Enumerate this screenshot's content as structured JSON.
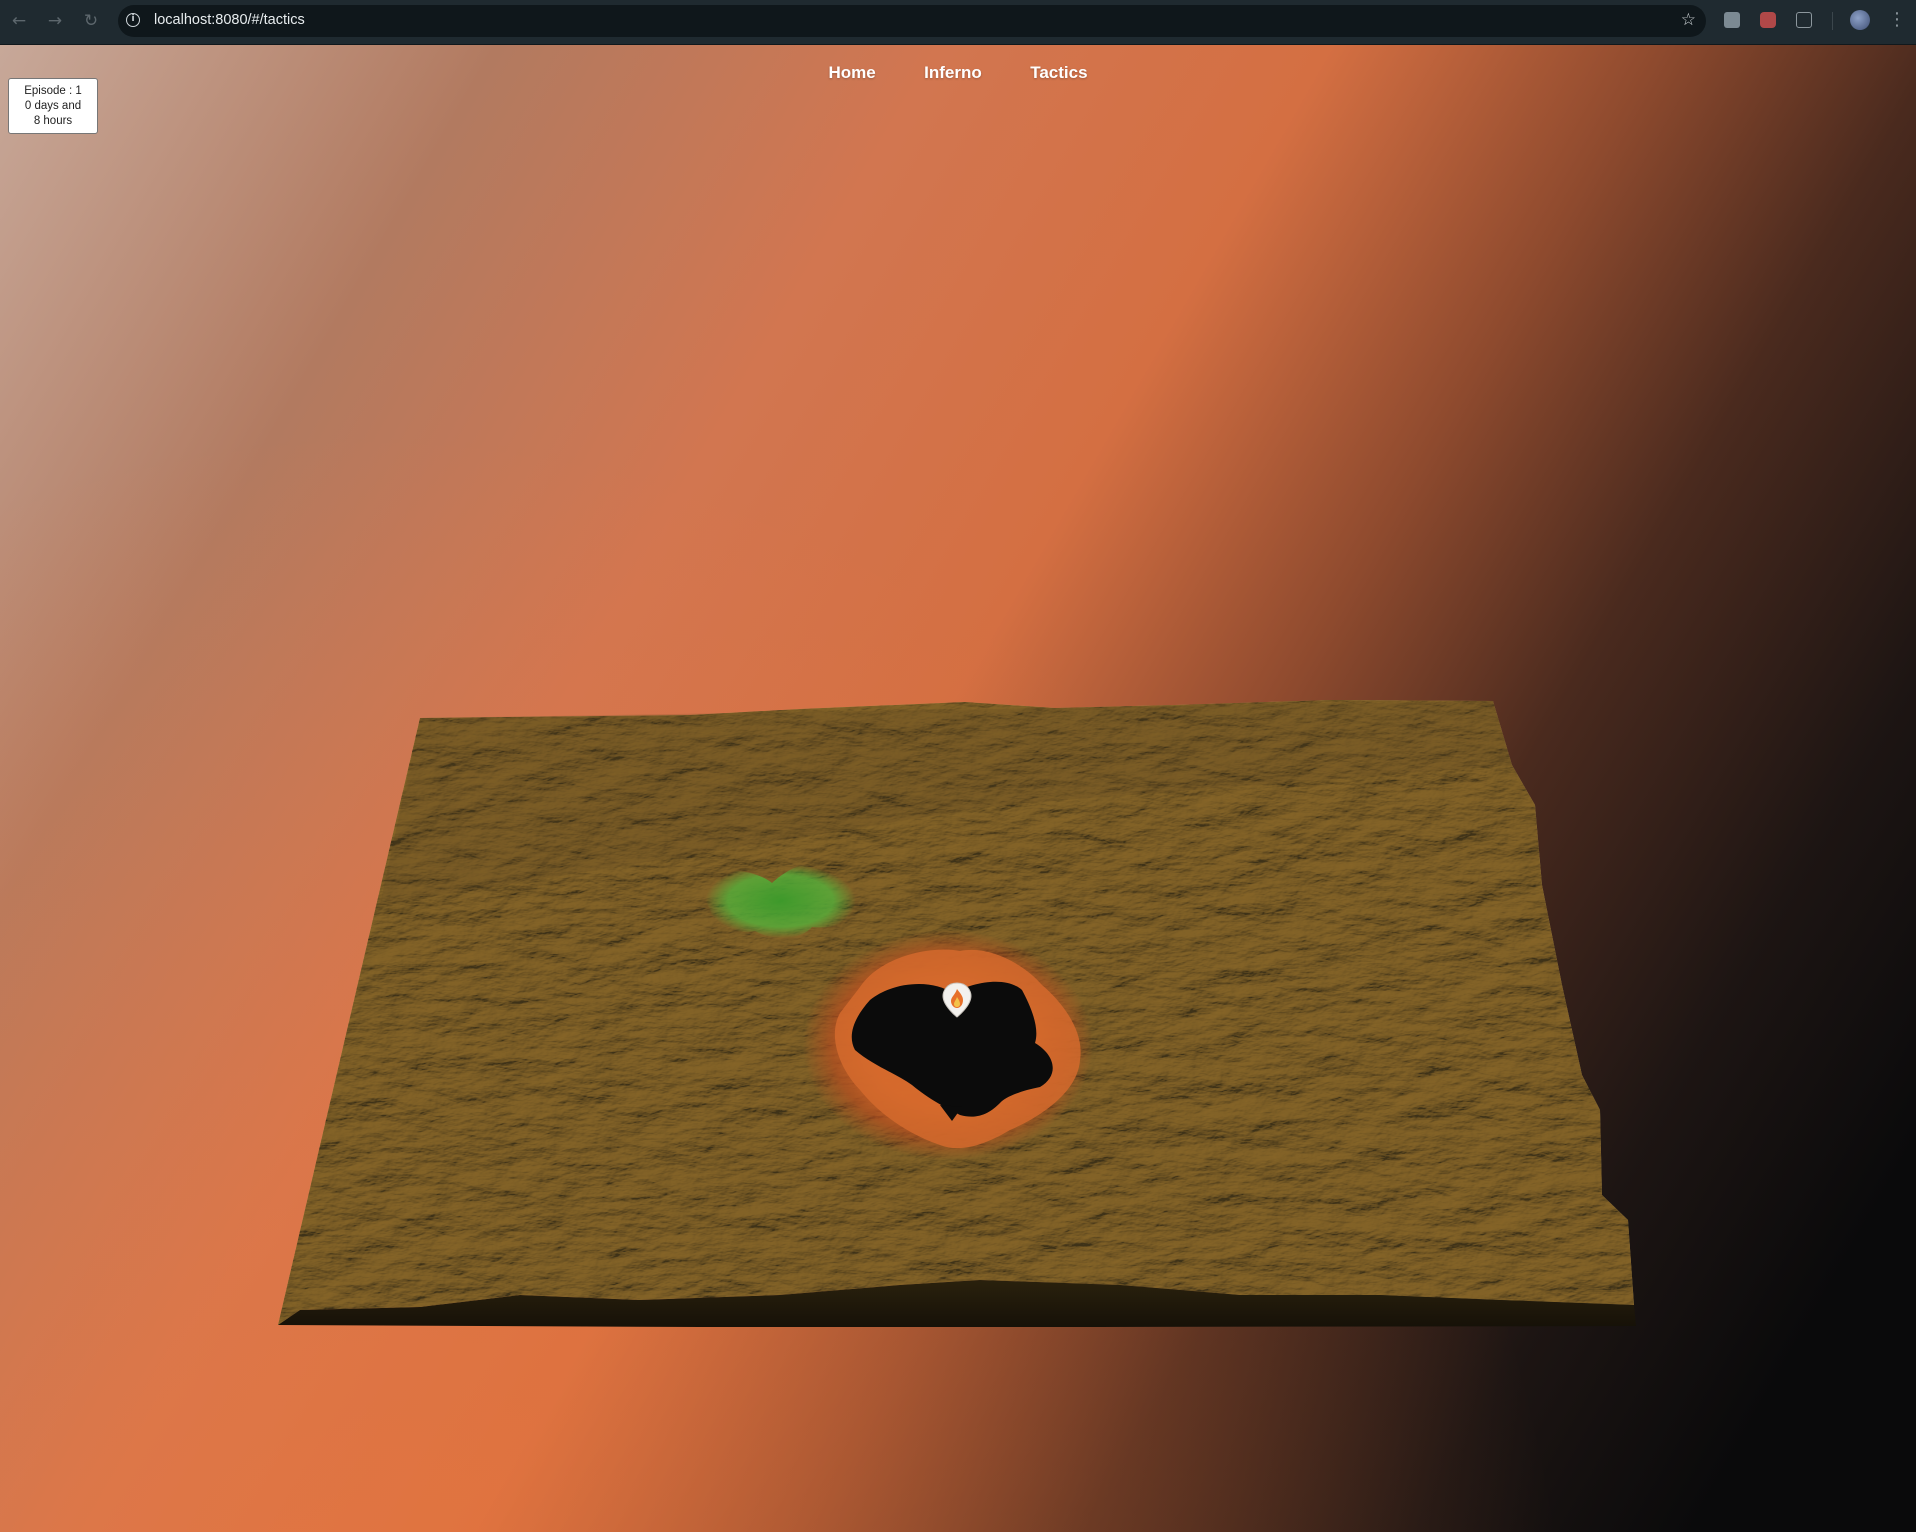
{
  "browser": {
    "url": "localhost:8080/#/tactics",
    "back_icon": "arrow-left-icon",
    "forward_icon": "arrow-right-icon",
    "reload_icon": "reload-icon",
    "site_info_icon": "info-icon",
    "bookmark_icon": "star-icon",
    "menu_icon": "kebab-menu-icon"
  },
  "episode": {
    "line1": "Episode : 1",
    "line2": "0 days and",
    "line3": "8 hours"
  },
  "nav": {
    "items": [
      {
        "label": "Home"
      },
      {
        "label": "Inferno"
      },
      {
        "label": "Tactics"
      }
    ]
  },
  "scene": {
    "terrain_color": "#8a6e34",
    "burned_color": "#0b0b0b",
    "fire_edge_color": "#d8612a",
    "vegetation_color": "#3f9f2a",
    "marker_icon": "fire-location-pin-icon"
  }
}
